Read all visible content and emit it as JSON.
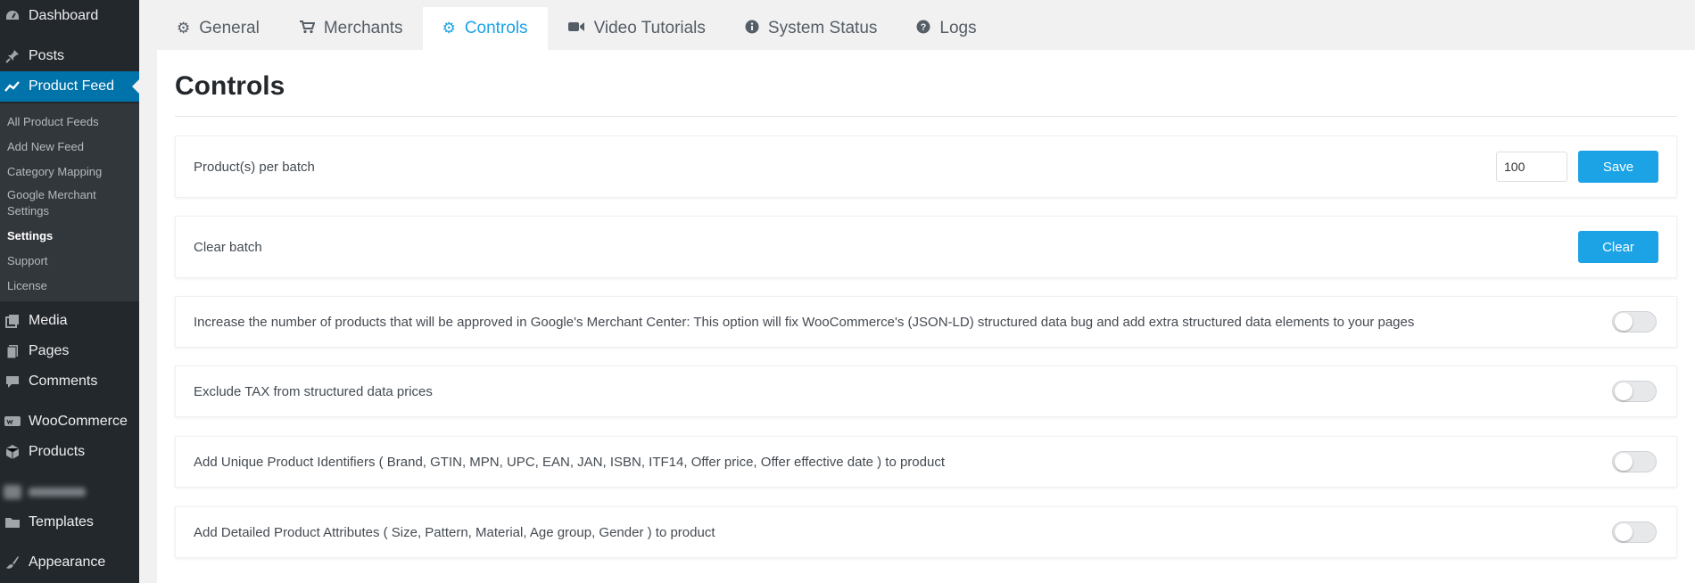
{
  "sidebar": {
    "items": [
      {
        "key": "dashboard",
        "label": "Dashboard",
        "icon": "dashboard-icon"
      },
      {
        "key": "posts",
        "label": "Posts",
        "icon": "pin-icon"
      },
      {
        "key": "product-feed",
        "label": "Product Feed",
        "icon": "chart-line-icon",
        "active": true
      },
      {
        "key": "media",
        "label": "Media",
        "icon": "media-icon"
      },
      {
        "key": "pages",
        "label": "Pages",
        "icon": "pages-icon"
      },
      {
        "key": "comments",
        "label": "Comments",
        "icon": "comment-icon"
      },
      {
        "key": "woocommerce",
        "label": "WooCommerce",
        "icon": "woocommerce-icon"
      },
      {
        "key": "products",
        "label": "Products",
        "icon": "box-icon"
      },
      {
        "key": "templates",
        "label": "Templates",
        "icon": "folder-icon"
      },
      {
        "key": "appearance",
        "label": "Appearance",
        "icon": "brush-icon"
      }
    ],
    "submenu": [
      {
        "label": "All Product Feeds"
      },
      {
        "label": "Add New Feed"
      },
      {
        "label": "Category Mapping"
      },
      {
        "label": "Google Merchant Settings"
      },
      {
        "label": "Settings",
        "current": true
      },
      {
        "label": "Support"
      },
      {
        "label": "License"
      }
    ]
  },
  "tabs": [
    {
      "label": "General",
      "icon": "gear-icon"
    },
    {
      "label": "Merchants",
      "icon": "cart-icon"
    },
    {
      "label": "Controls",
      "icon": "gears-icon",
      "active": true
    },
    {
      "label": "Video Tutorials",
      "icon": "video-camera-icon"
    },
    {
      "label": "System Status",
      "icon": "info-circle-icon"
    },
    {
      "label": "Logs",
      "icon": "question-circle-icon"
    }
  ],
  "page": {
    "title": "Controls",
    "batch": {
      "label": "Product(s) per batch",
      "value": "100",
      "save_label": "Save"
    },
    "clear": {
      "label": "Clear batch",
      "button_label": "Clear"
    },
    "options": [
      {
        "label": "Increase the number of products that will be approved in Google's Merchant Center: This option will fix WooCommerce's (JSON-LD) structured data bug and add extra structured data elements to your pages",
        "enabled": false
      },
      {
        "label": "Exclude TAX from structured data prices",
        "enabled": false
      },
      {
        "label": "Add Unique Product Identifiers ( Brand, GTIN, MPN, UPC, EAN, JAN, ISBN, ITF14, Offer price, Offer effective date ) to product",
        "enabled": false
      },
      {
        "label": "Add Detailed Product Attributes ( Size, Pattern, Material, Age group, Gender ) to product",
        "enabled": false
      }
    ]
  },
  "colors": {
    "accent": "#1ba3e6",
    "sidebar_bg": "#23282d",
    "sidebar_active": "#0073aa"
  }
}
